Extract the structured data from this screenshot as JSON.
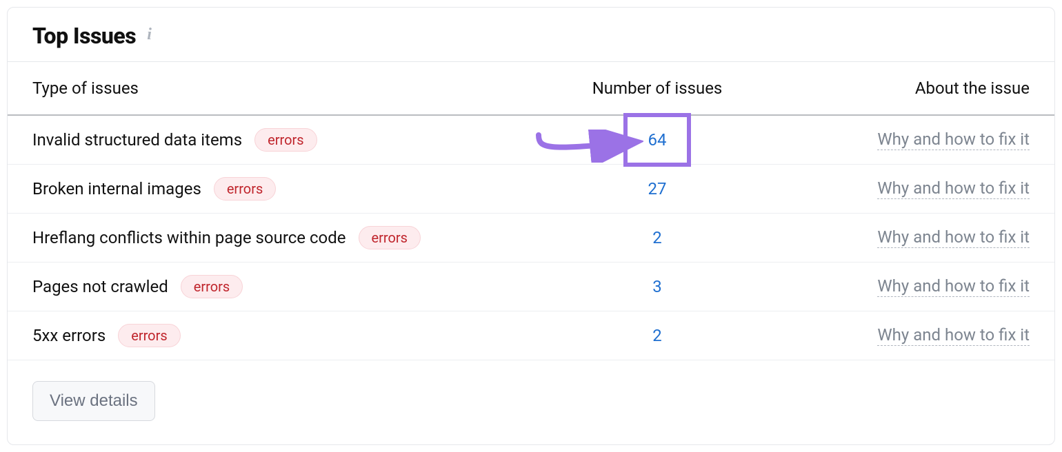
{
  "header": {
    "title": "Top Issues"
  },
  "columns": {
    "type": "Type of issues",
    "number": "Number of issues",
    "about": "About the issue"
  },
  "badge_label": "errors",
  "about_link_label": "Why and how to fix it",
  "view_details_label": "View details",
  "issues": [
    {
      "name": "Invalid structured data items",
      "count": 64,
      "highlighted": true
    },
    {
      "name": "Broken internal images",
      "count": 27,
      "highlighted": false
    },
    {
      "name": "Hreflang conflicts within page source code",
      "count": 2,
      "highlighted": false
    },
    {
      "name": "Pages not crawled",
      "count": 3,
      "highlighted": false
    },
    {
      "name": "5xx errors",
      "count": 2,
      "highlighted": false
    }
  ]
}
